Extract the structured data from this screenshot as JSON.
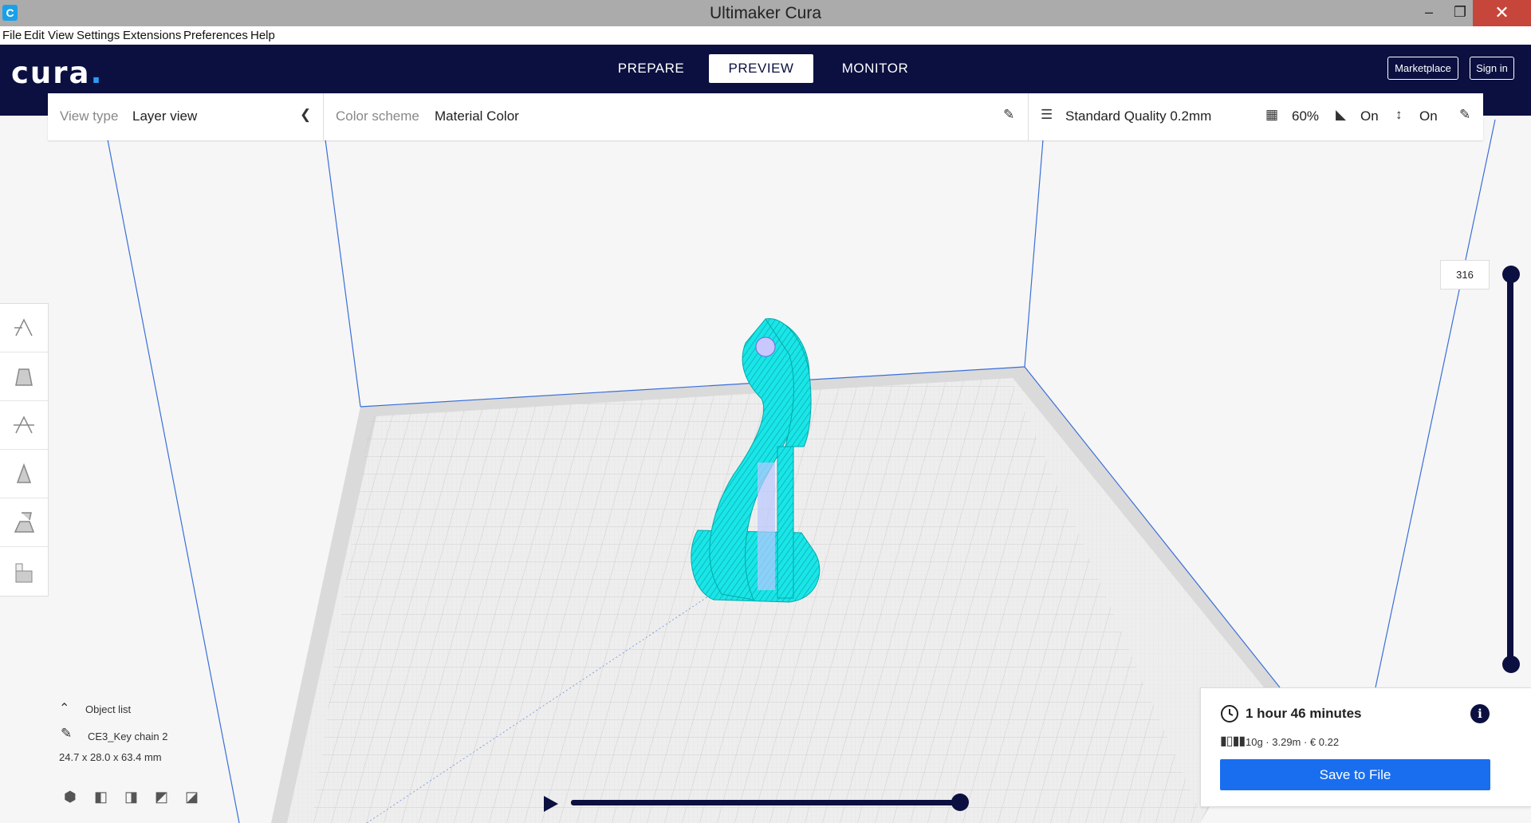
{
  "window": {
    "title": "Ultimaker Cura",
    "app_icon": "C",
    "minimize": "–",
    "maximize": "❐",
    "close": "✕"
  },
  "menu": [
    "File",
    "Edit",
    "View",
    "Settings",
    "Extensions",
    "Preferences",
    "Help"
  ],
  "header": {
    "logo_text": "cura",
    "logo_dot": ".",
    "tabs": [
      "PREPARE",
      "PREVIEW",
      "MONITOR"
    ],
    "active_tab": "PREVIEW",
    "marketplace": "Marketplace",
    "sign_in": "Sign in"
  },
  "toolbar": {
    "view_type_label": "View type",
    "view_type_value": "Layer view",
    "color_scheme_label": "Color scheme",
    "color_scheme_value": "Material Color",
    "profile": "Standard Quality 0.2mm",
    "infill": "60%",
    "support": "On",
    "adhesion": "On"
  },
  "layer_slider": {
    "value": "316"
  },
  "object_list": {
    "title": "Object list",
    "object_name": "CE3_Key chain 2",
    "dimensions": "24.7 x 28.0 x 63.4 mm"
  },
  "print_info": {
    "time": "1 hour 46 minutes",
    "material": "10g · 3.29m · € 0.22",
    "save_button": "Save to File"
  },
  "colors": {
    "brand": "#0b1040",
    "accent": "#196ef0",
    "model": "#17e8e8"
  }
}
